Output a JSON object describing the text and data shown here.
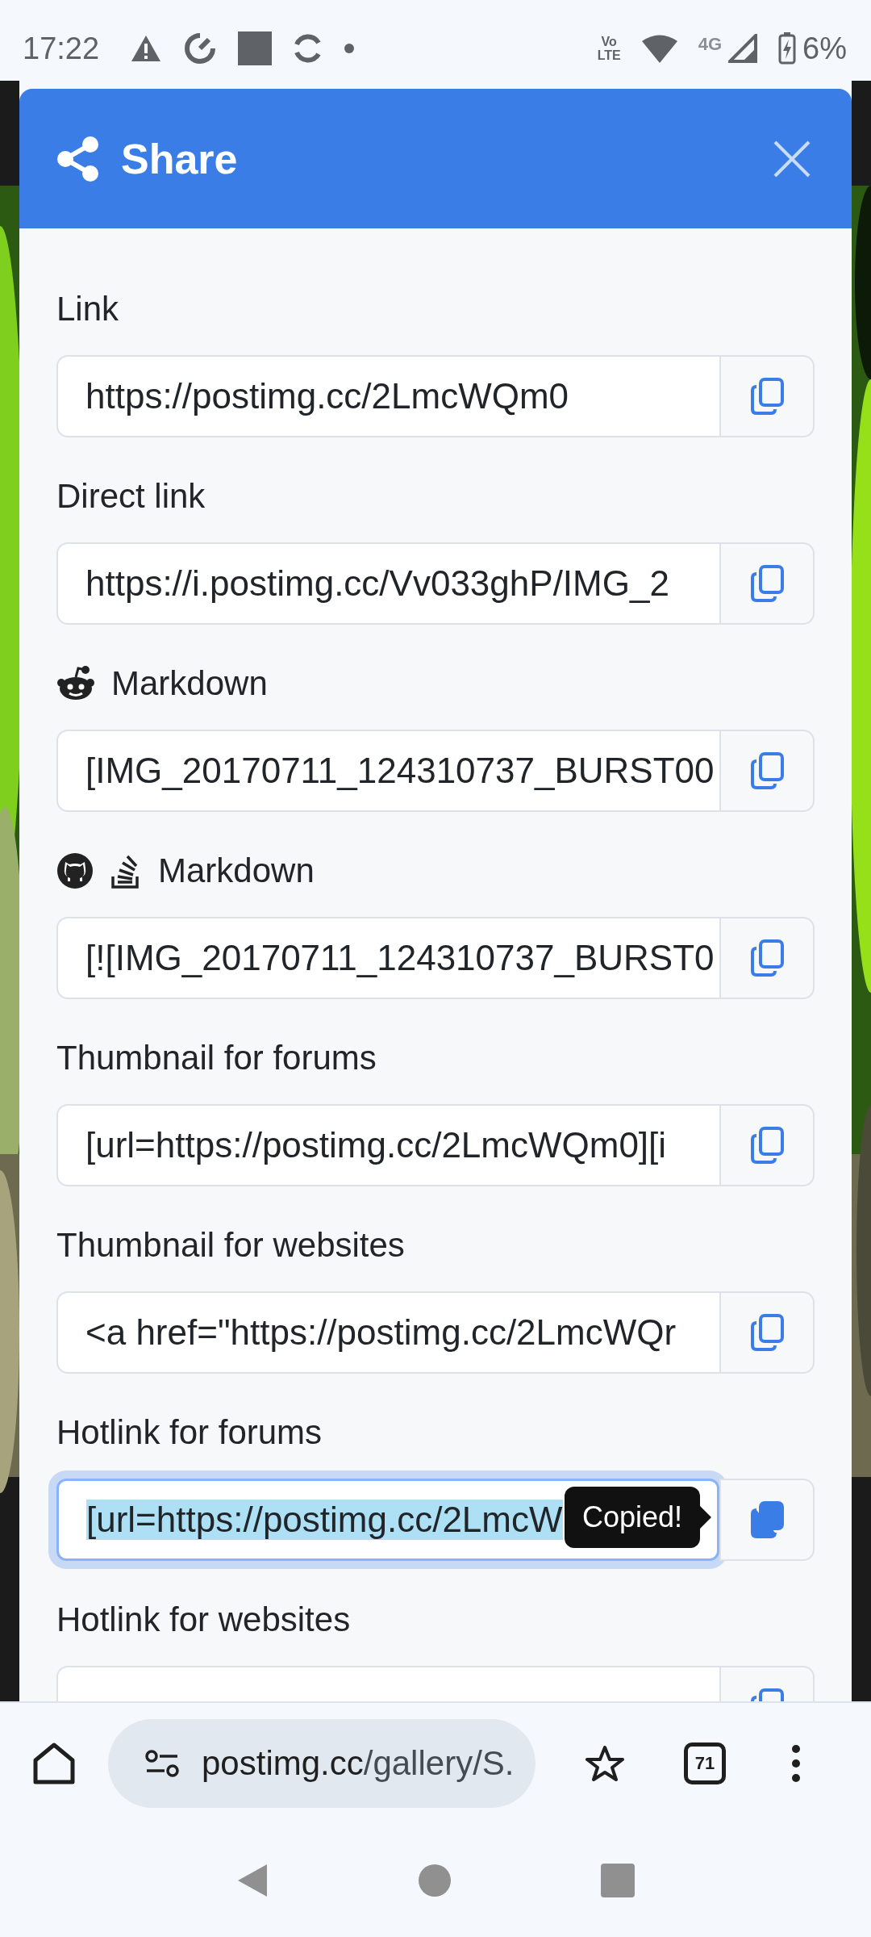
{
  "status_bar": {
    "time": "17:22",
    "volte_top": "Vo",
    "volte_bottom": "LTE",
    "network": "4G",
    "battery": "6%"
  },
  "dialog": {
    "title": "Share",
    "fields": [
      {
        "label": "Link",
        "value": "https://postimg.cc/2LmcWQm0",
        "focused": false,
        "selected": false
      },
      {
        "label": "Direct link",
        "value": "https://i.postimg.cc/Vv033ghP/IMG_2",
        "focused": false,
        "selected": false
      },
      {
        "label": "Markdown",
        "icons": [
          {
            "kind": "reddit"
          }
        ],
        "value": "[IMG_20170711_124310737_BURST00",
        "focused": false,
        "selected": false
      },
      {
        "label": "Markdown",
        "icons": [
          {
            "kind": "github"
          },
          {
            "kind": "stack"
          }
        ],
        "value": "[![IMG_20170711_124310737_BURST0",
        "focused": false,
        "selected": false
      },
      {
        "label": "Thumbnail for forums",
        "value": "[url=https://postimg.cc/2LmcWQm0][i",
        "focused": false,
        "selected": false
      },
      {
        "label": "Thumbnail for websites",
        "value": "<a href=\"https://postimg.cc/2LmcWQr",
        "focused": false,
        "selected": false
      },
      {
        "label": "Hotlink for forums",
        "value": "[url=https://postimg.cc/2LmcW",
        "focused": true,
        "selected": true,
        "tooltip": "Copied!"
      },
      {
        "label": "Hotlink for websites",
        "focused": false
      }
    ]
  },
  "browser_bar": {
    "url_domain": "postimg.cc",
    "url_path": "/gallery/S.",
    "tab_count": "71"
  }
}
